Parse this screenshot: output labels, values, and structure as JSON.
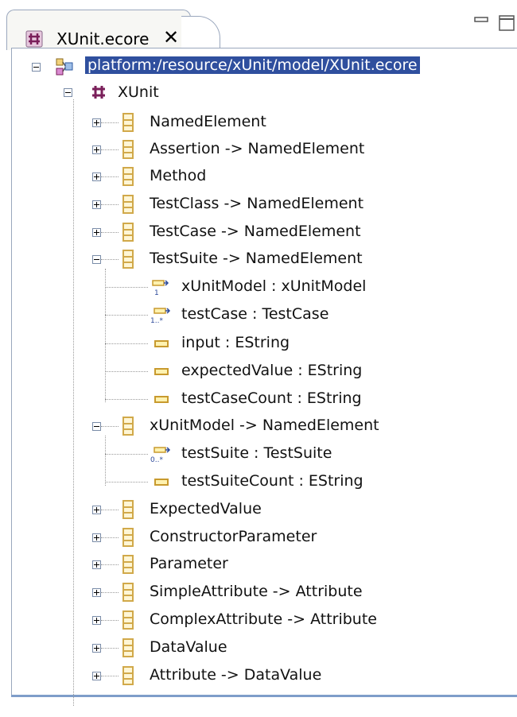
{
  "editor_tab": {
    "title": "XUnit.ecore",
    "close_glyph": "✕",
    "icon": "ecore-package-icon"
  },
  "window_controls": [
    "minimize-icon",
    "maximize-icon"
  ],
  "tree": {
    "resource": {
      "label": "platform:/resource/xUnit/model/XUnit.ecore",
      "selected": true
    },
    "package": {
      "label": "XUnit"
    },
    "items": [
      {
        "label": "NamedElement",
        "expanded": false
      },
      {
        "label": "Assertion -> NamedElement",
        "expanded": false
      },
      {
        "label": "Method",
        "expanded": false
      },
      {
        "label": "TestClass -> NamedElement",
        "expanded": false
      },
      {
        "label": "TestCase -> NamedElement",
        "expanded": false
      },
      {
        "label": "TestSuite -> NamedElement",
        "expanded": true,
        "children": [
          {
            "label": "xUnitModel : xUnitModel",
            "icon": "reference-single-icon"
          },
          {
            "label": "testCase : TestCase",
            "icon": "reference-many-icon"
          },
          {
            "label": "input : EString",
            "icon": "attribute-icon"
          },
          {
            "label": "expectedValue : EString",
            "icon": "attribute-icon"
          },
          {
            "label": "testCaseCount : EString",
            "icon": "attribute-icon"
          }
        ]
      },
      {
        "label": "xUnitModel -> NamedElement",
        "expanded": true,
        "children": [
          {
            "label": "testSuite : TestSuite",
            "icon": "reference-many-icon"
          },
          {
            "label": "testSuiteCount : EString",
            "icon": "attribute-icon"
          }
        ]
      },
      {
        "label": "ExpectedValue",
        "expanded": false
      },
      {
        "label": "ConstructorParameter",
        "expanded": false
      },
      {
        "label": "Parameter",
        "expanded": false
      },
      {
        "label": "SimpleAttribute -> Attribute",
        "expanded": false
      },
      {
        "label": "ComplexAttribute -> Attribute",
        "expanded": false
      },
      {
        "label": "DataValue",
        "expanded": false
      },
      {
        "label": "Attribute -> DataValue",
        "expanded": false
      }
    ]
  }
}
